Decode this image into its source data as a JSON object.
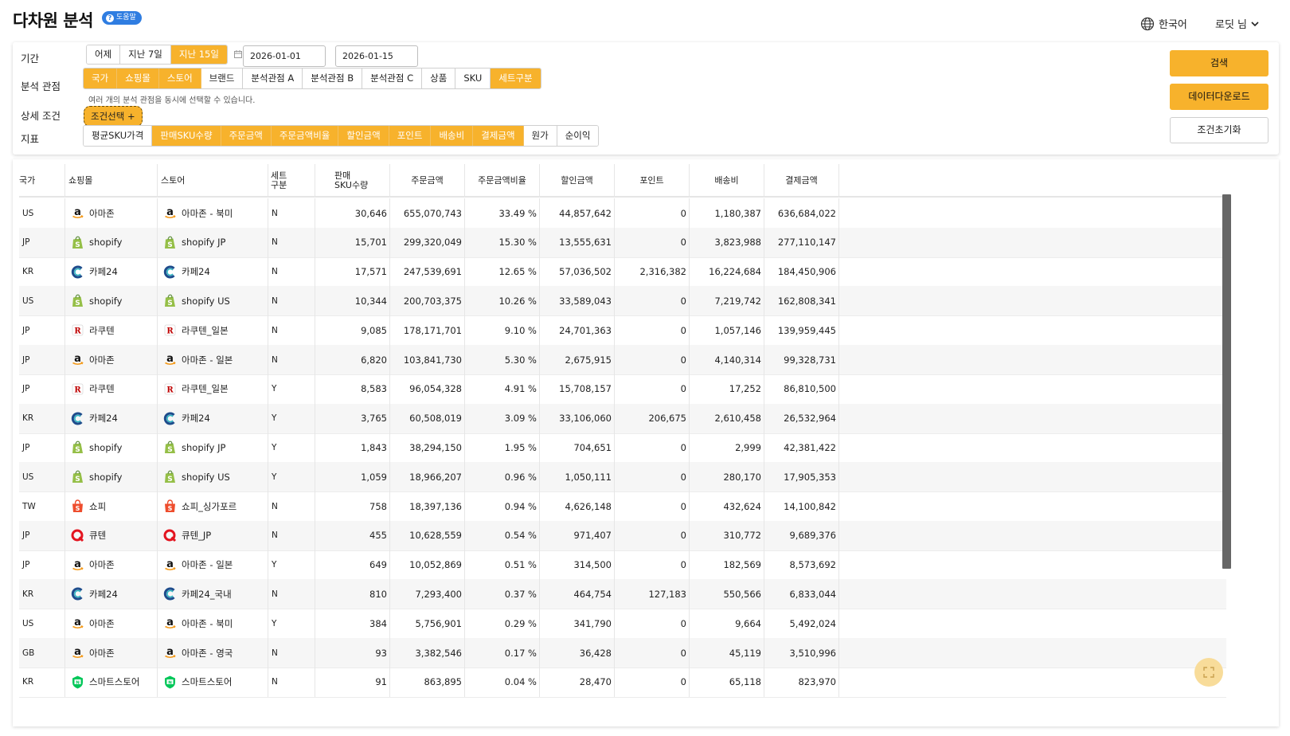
{
  "header": {
    "title": "다차원 분석",
    "help_badge": "도움말",
    "language": "한국어",
    "user": "로딧 님"
  },
  "filters": {
    "period_label": "기간",
    "period_options": [
      "어제",
      "지난 7일",
      "지난 15일"
    ],
    "period_selected": "지난 15일",
    "date_start": "2026-01-01",
    "date_sep": "~",
    "date_end": "2026-01-15",
    "view_label": "분석 관점",
    "view_options": [
      "국가",
      "쇼핑몰",
      "스토어",
      "브랜드",
      "분석관점 A",
      "분석관점 B",
      "분석관점 C",
      "상품",
      "SKU",
      "세트구분"
    ],
    "view_selected": [
      "국가",
      "쇼핑몰",
      "스토어",
      "세트구분"
    ],
    "view_hint": "여러 개의 분석 관점을 동시에 선택할 수 있습니다.",
    "detail_label": "상세 조건",
    "condition_button": "조건선택 +",
    "metric_label": "지표",
    "metric_options": [
      "평균SKU가격",
      "판매SKU수량",
      "주문금액",
      "주문금액비율",
      "할인금액",
      "포인트",
      "배송비",
      "결제금액",
      "원가",
      "순이익"
    ],
    "metric_selected": [
      "판매SKU수량",
      "주문금액",
      "주문금액비율",
      "할인금액",
      "포인트",
      "배송비",
      "결제금액"
    ]
  },
  "actions": {
    "search": "검색",
    "download": "데이터다운로드",
    "reset": "조건초기화"
  },
  "table": {
    "columns": {
      "country": "국가",
      "mall": "쇼핑몰",
      "store": "스토어",
      "set_1": "세트",
      "set_2": "구분",
      "qty_1": "판매",
      "qty_2": "SKU수량",
      "order_amount": "주문금액",
      "order_ratio": "주문금액비율",
      "discount": "할인금액",
      "point": "포인트",
      "shipping": "배송비",
      "payment": "결제금액"
    },
    "rows": [
      {
        "country": "US",
        "mall": "아마존",
        "mall_logo": "amazon-logo-icon",
        "store": "아마존 - 북미",
        "set": "N",
        "qty": "30,646",
        "order": "655,070,743",
        "ratio": "33.49 %",
        "discount": "44,857,642",
        "point": "0",
        "shipping": "1,180,387",
        "payment": "636,684,022"
      },
      {
        "country": "JP",
        "mall": "shopify",
        "mall_logo": "shopify-logo-icon",
        "store": "shopify JP",
        "set": "N",
        "qty": "15,701",
        "order": "299,320,049",
        "ratio": "15.30 %",
        "discount": "13,555,631",
        "point": "0",
        "shipping": "3,823,988",
        "payment": "277,110,147"
      },
      {
        "country": "KR",
        "mall": "카페24",
        "mall_logo": "cafe24-logo-icon",
        "store": "카페24",
        "set": "N",
        "qty": "17,571",
        "order": "247,539,691",
        "ratio": "12.65 %",
        "discount": "57,036,502",
        "point": "2,316,382",
        "shipping": "16,224,684",
        "payment": "184,450,906"
      },
      {
        "country": "US",
        "mall": "shopify",
        "mall_logo": "shopify-logo-icon",
        "store": "shopify US",
        "set": "N",
        "qty": "10,344",
        "order": "200,703,375",
        "ratio": "10.26 %",
        "discount": "33,589,043",
        "point": "0",
        "shipping": "7,219,742",
        "payment": "162,808,341"
      },
      {
        "country": "JP",
        "mall": "라쿠텐",
        "mall_logo": "rakuten-logo-icon",
        "store": "라쿠텐_일본",
        "set": "N",
        "qty": "9,085",
        "order": "178,171,701",
        "ratio": "9.10 %",
        "discount": "24,701,363",
        "point": "0",
        "shipping": "1,057,146",
        "payment": "139,959,445"
      },
      {
        "country": "JP",
        "mall": "아마존",
        "mall_logo": "amazon-logo-icon",
        "store": "아마존 - 일본",
        "set": "N",
        "qty": "6,820",
        "order": "103,841,730",
        "ratio": "5.30 %",
        "discount": "2,675,915",
        "point": "0",
        "shipping": "4,140,314",
        "payment": "99,328,731"
      },
      {
        "country": "JP",
        "mall": "라쿠텐",
        "mall_logo": "rakuten-logo-icon",
        "store": "라쿠텐_일본",
        "set": "Y",
        "qty": "8,583",
        "order": "96,054,328",
        "ratio": "4.91 %",
        "discount": "15,708,157",
        "point": "0",
        "shipping": "17,252",
        "payment": "86,810,500"
      },
      {
        "country": "KR",
        "mall": "카페24",
        "mall_logo": "cafe24-logo-icon",
        "store": "카페24",
        "set": "Y",
        "qty": "3,765",
        "order": "60,508,019",
        "ratio": "3.09 %",
        "discount": "33,106,060",
        "point": "206,675",
        "shipping": "2,610,458",
        "payment": "26,532,964"
      },
      {
        "country": "JP",
        "mall": "shopify",
        "mall_logo": "shopify-logo-icon",
        "store": "shopify JP",
        "set": "Y",
        "qty": "1,843",
        "order": "38,294,150",
        "ratio": "1.95 %",
        "discount": "704,651",
        "point": "0",
        "shipping": "2,999",
        "payment": "42,381,422"
      },
      {
        "country": "US",
        "mall": "shopify",
        "mall_logo": "shopify-logo-icon",
        "store": "shopify US",
        "set": "Y",
        "qty": "1,059",
        "order": "18,966,207",
        "ratio": "0.96 %",
        "discount": "1,050,111",
        "point": "0",
        "shipping": "280,170",
        "payment": "17,905,353"
      },
      {
        "country": "TW",
        "mall": "쇼피",
        "mall_logo": "shopee-logo-icon",
        "store": "쇼피_싱가포르",
        "set": "N",
        "qty": "758",
        "order": "18,397,136",
        "ratio": "0.94 %",
        "discount": "4,626,148",
        "point": "0",
        "shipping": "432,624",
        "payment": "14,100,842"
      },
      {
        "country": "JP",
        "mall": "큐텐",
        "mall_logo": "qoo10-logo-icon",
        "store": "큐텐_JP",
        "set": "N",
        "qty": "455",
        "order": "10,628,559",
        "ratio": "0.54 %",
        "discount": "971,407",
        "point": "0",
        "shipping": "310,772",
        "payment": "9,689,376"
      },
      {
        "country": "JP",
        "mall": "아마존",
        "mall_logo": "amazon-logo-icon",
        "store": "아마존 - 일본",
        "set": "Y",
        "qty": "649",
        "order": "10,052,869",
        "ratio": "0.51 %",
        "discount": "314,500",
        "point": "0",
        "shipping": "182,569",
        "payment": "8,573,692"
      },
      {
        "country": "KR",
        "mall": "카페24",
        "mall_logo": "cafe24-logo-icon",
        "store": "카페24_국내",
        "set": "N",
        "qty": "810",
        "order": "7,293,400",
        "ratio": "0.37 %",
        "discount": "464,754",
        "point": "127,183",
        "shipping": "550,566",
        "payment": "6,833,044"
      },
      {
        "country": "US",
        "mall": "아마존",
        "mall_logo": "amazon-logo-icon",
        "store": "아마존 - 북미",
        "set": "Y",
        "qty": "384",
        "order": "5,756,901",
        "ratio": "0.29 %",
        "discount": "341,790",
        "point": "0",
        "shipping": "9,664",
        "payment": "5,492,024"
      },
      {
        "country": "GB",
        "mall": "아마존",
        "mall_logo": "amazon-logo-icon",
        "store": "아마존 - 영국",
        "set": "N",
        "qty": "93",
        "order": "3,382,546",
        "ratio": "0.17 %",
        "discount": "36,428",
        "point": "0",
        "shipping": "45,119",
        "payment": "3,510,996"
      },
      {
        "country": "KR",
        "mall": "스마트스토어",
        "mall_logo": "smartstore-logo-icon",
        "store": "스마트스토어",
        "set": "N",
        "qty": "91",
        "order": "863,895",
        "ratio": "0.04 %",
        "discount": "28,470",
        "point": "0",
        "shipping": "65,118",
        "payment": "823,970"
      }
    ]
  },
  "colors": {
    "accent": "#f7b22c",
    "help_badge": "#2f7de1",
    "row_alt": "#f6f6f6"
  },
  "icons": {
    "language": "globe-icon",
    "user_menu": "chevron-down-icon",
    "calendar": "calendar-icon",
    "fullscreen": "fullscreen-icon"
  }
}
